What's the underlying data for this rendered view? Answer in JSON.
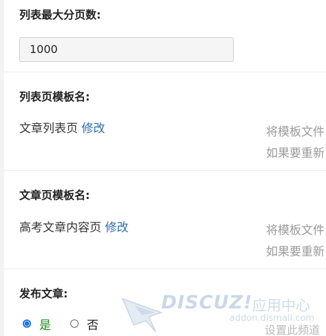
{
  "settings": {
    "max_pages": {
      "label": "列表最大分页数:",
      "value": "1000"
    },
    "list_template": {
      "label": "列表页模板名:",
      "value": "文章列表页",
      "edit_link": "修改",
      "hint_line1": "将模板文件",
      "hint_line2": "如果要重新"
    },
    "article_template": {
      "label": "文章页模板名:",
      "value": "高考文章内容页",
      "edit_link": "修改",
      "hint_line1": "将模板文件",
      "hint_line2": "如果要重新"
    },
    "publish": {
      "label": "发布文章:",
      "option_yes": "是",
      "option_no": "否",
      "selected": "是",
      "hint": "设置此频道"
    }
  },
  "watermark": {
    "brand": "DISCUZ!",
    "brand_cn": "应用中心",
    "domain": "addon.dismall.com"
  },
  "colors": {
    "link": "#2a6db0",
    "radio_selected": "#1a73e8",
    "option_yes": "#1a8a1a",
    "hint": "#9a9a9a"
  }
}
